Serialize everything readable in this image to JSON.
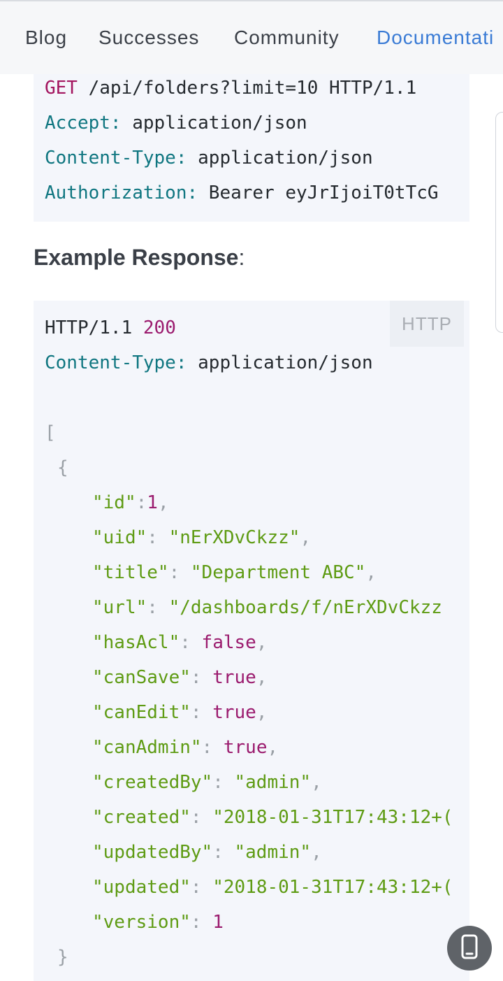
{
  "nav": {
    "links": [
      "Blog",
      "Successes",
      "Community",
      "Documentati"
    ],
    "active_index": 3
  },
  "request_block": {
    "lines": [
      {
        "method": "GET",
        "rest": " /api/folders?limit=10 HTTP/1.1"
      },
      {
        "header": "Accept:",
        "value": " application/json"
      },
      {
        "header": "Content-Type:",
        "value": " application/json"
      },
      {
        "header": "Authorization:",
        "value": " Bearer eyJrIjoiT0tTcG"
      }
    ]
  },
  "response_heading": {
    "text": "Example Response",
    "colon": ":"
  },
  "response_block": {
    "lang_badge": "HTTP",
    "status_line": {
      "proto": "HTTP/1.1 ",
      "code": "200"
    },
    "content_type": {
      "header": "Content-Type:",
      "value": " application/json"
    },
    "open_bracket": "[",
    "open_brace": "{",
    "close_brace": "}",
    "fields": [
      {
        "key": "\"id\"",
        "sep": ":",
        "value": "1",
        "vtype": "num",
        "comma": ","
      },
      {
        "key": "\"uid\"",
        "sep": ": ",
        "value": "\"nErXDvCkzz\"",
        "vtype": "str",
        "comma": ","
      },
      {
        "key": "\"title\"",
        "sep": ": ",
        "value": "\"Department ABC\"",
        "vtype": "str",
        "comma": ","
      },
      {
        "key": "\"url\"",
        "sep": ": ",
        "value": "\"/dashboards/f/nErXDvCkzz",
        "vtype": "str",
        "comma": ""
      },
      {
        "key": "\"hasAcl\"",
        "sep": ": ",
        "value": "false",
        "vtype": "bool",
        "comma": ","
      },
      {
        "key": "\"canSave\"",
        "sep": ": ",
        "value": "true",
        "vtype": "bool",
        "comma": ","
      },
      {
        "key": "\"canEdit\"",
        "sep": ": ",
        "value": "true",
        "vtype": "bool",
        "comma": ","
      },
      {
        "key": "\"canAdmin\"",
        "sep": ": ",
        "value": "true",
        "vtype": "bool",
        "comma": ","
      },
      {
        "key": "\"createdBy\"",
        "sep": ": ",
        "value": "\"admin\"",
        "vtype": "str",
        "comma": ","
      },
      {
        "key": "\"created\"",
        "sep": ": ",
        "value": "\"2018-01-31T17:43:12+(",
        "vtype": "str",
        "comma": ""
      },
      {
        "key": "\"updatedBy\"",
        "sep": ": ",
        "value": "\"admin\"",
        "vtype": "str",
        "comma": ","
      },
      {
        "key": "\"updated\"",
        "sep": ": ",
        "value": "\"2018-01-31T17:43:12+(",
        "vtype": "str",
        "comma": ""
      },
      {
        "key": "\"version\"",
        "sep": ": ",
        "value": "1",
        "vtype": "num",
        "comma": ""
      }
    ]
  },
  "fab": {
    "icon": "phone-icon"
  },
  "colors": {
    "accent": "#3a7bd5",
    "keyword": "#a3155f",
    "header_name": "#0f7680",
    "string": "#5e9b13",
    "code_bg": "#f4f6fb"
  }
}
